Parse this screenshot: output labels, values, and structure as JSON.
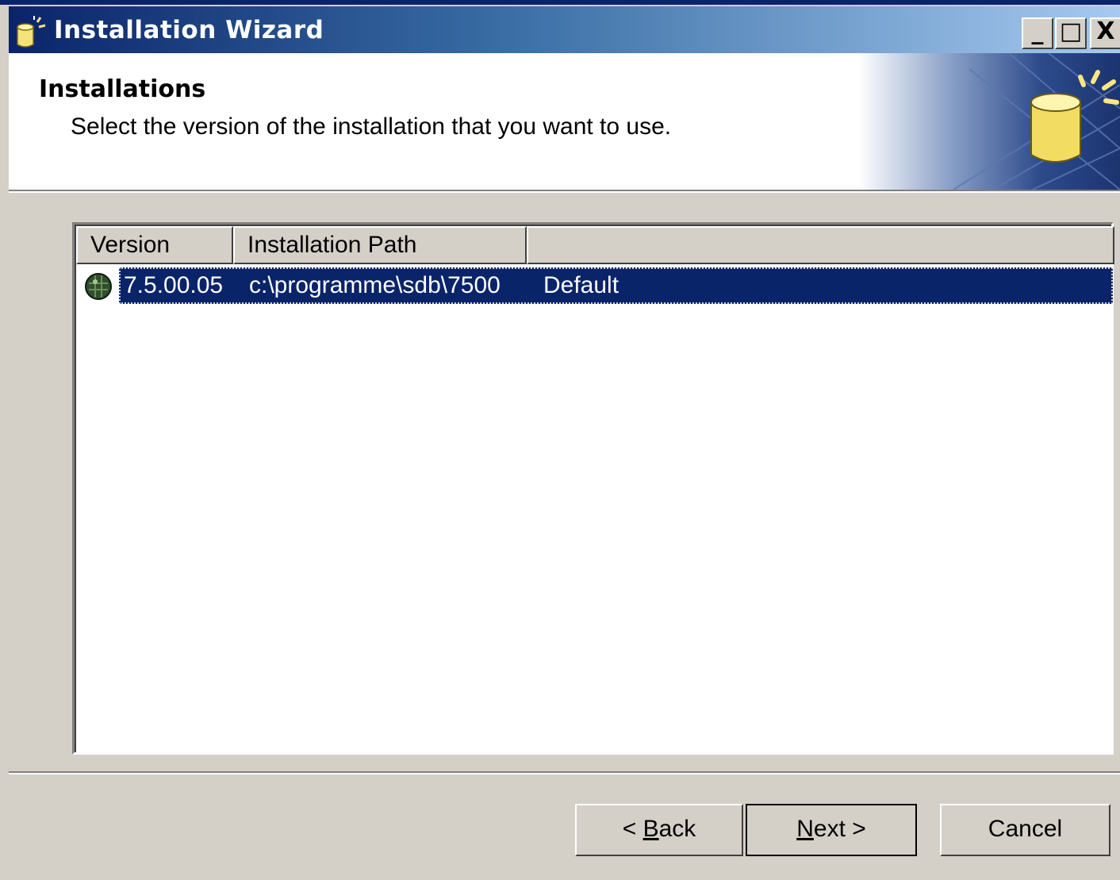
{
  "window": {
    "title": "Installation Wizard",
    "controls": {
      "minimize": "_",
      "maximize": "□",
      "close": "X"
    }
  },
  "header": {
    "title": "Installations",
    "subtitle": "Select the version of the installation that you want to use."
  },
  "list": {
    "columns": [
      "Version",
      "Installation Path",
      ""
    ],
    "rows": [
      {
        "version": "7.5.00.05",
        "path": "c:\\programme\\sdb\\7500",
        "label": "Default",
        "icon": "database-instance-icon",
        "selected": true
      }
    ]
  },
  "buttons": {
    "back": {
      "prefix": "< ",
      "mnemonic": "B",
      "rest": "ack"
    },
    "next": {
      "prefix": "",
      "mnemonic": "N",
      "rest": "ext >"
    },
    "cancel": "Cancel"
  },
  "colors": {
    "titlebar_start": "#0a246a",
    "titlebar_end": "#a6caf0",
    "selection": "#0a246a",
    "face": "#d4d0c8"
  }
}
